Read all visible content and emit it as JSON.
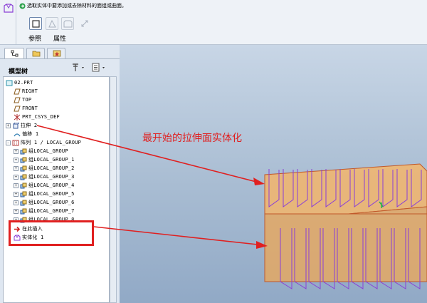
{
  "header": {
    "hint_text": "选取实体中要添加或去除材料的面组或曲面。",
    "tab_reference": "参照",
    "tab_properties": "属性"
  },
  "sidebar": {
    "title": "模型树",
    "items": [
      {
        "label": "02.PRT",
        "icon": "part-icon"
      },
      {
        "label": "RIGHT",
        "icon": "datum-plane-icon"
      },
      {
        "label": "TOP",
        "icon": "datum-plane-icon"
      },
      {
        "label": "FRONT",
        "icon": "datum-plane-icon"
      },
      {
        "label": "PRT_CSYS_DEF",
        "icon": "csys-icon"
      },
      {
        "label": "拉伸 2",
        "icon": "extrude-icon"
      },
      {
        "label": "偏移 1",
        "icon": "offset-icon"
      },
      {
        "label": "阵列 1 / LOCAL_GROUP",
        "icon": "pattern-icon"
      },
      {
        "label": "组LOCAL_GROUP",
        "icon": "group-icon"
      },
      {
        "label": "组LOCAL_GROUP_1",
        "icon": "group-icon"
      },
      {
        "label": "组LOCAL_GROUP_2",
        "icon": "group-icon"
      },
      {
        "label": "组LOCAL_GROUP_3",
        "icon": "group-icon"
      },
      {
        "label": "组LOCAL_GROUP_4",
        "icon": "group-icon"
      },
      {
        "label": "组LOCAL_GROUP_5",
        "icon": "group-icon"
      },
      {
        "label": "组LOCAL_GROUP_6",
        "icon": "group-icon"
      },
      {
        "label": "组LOCAL_GROUP_7",
        "icon": "group-icon"
      },
      {
        "label": "组LOCAL_GROUP_8",
        "icon": "group-icon"
      },
      {
        "label": "在此插入",
        "icon": "insert-arrow-icon"
      },
      {
        "label": "实体化 1",
        "icon": "solidify-icon"
      }
    ]
  },
  "annotation": {
    "text": "最开始的拉伸面实体化",
    "color": "#e02020"
  },
  "colors": {
    "accent": "#e02020",
    "surface": "#f3b56b",
    "pattern_lines": "#8a3fd6"
  }
}
